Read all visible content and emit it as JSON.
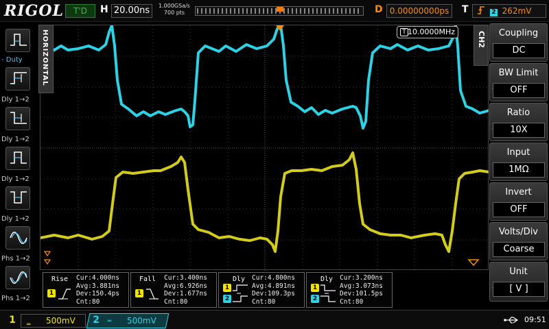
{
  "top": {
    "logo": "RIGOL",
    "trigger_status": "T'D",
    "h_label": "H",
    "timebase": "20.00ns",
    "sample_rate": "1.000GSa/s",
    "memory_depth": "700 pts",
    "d_label": "D",
    "delay": "0.00000000ps",
    "t_label": "T",
    "trigger_level": "262mV",
    "trigger_source": "2",
    "trigger_marker": "T"
  },
  "left_menu": {
    "horizontal_tab": "HORIZONTAL",
    "items": [
      {
        "label": "- Duty",
        "icon": "duty-cycle-icon"
      },
      {
        "label": "Dly 1→2",
        "icon": "delay-rise-rise-icon"
      },
      {
        "label": "Dly 1→2",
        "icon": "delay-fall-fall-icon"
      },
      {
        "label": "Dly 1→2",
        "icon": "delay-rise-fall-icon"
      },
      {
        "label": "Dly 1→2",
        "icon": "delay-fall-rise-icon"
      },
      {
        "label": "Phs 1→2",
        "icon": "phase-rise-icon"
      },
      {
        "label": "Phs 1→2",
        "icon": "phase-fall-icon"
      }
    ]
  },
  "grid": {
    "frequency": "10.0000MHz",
    "frequency_channel": "T"
  },
  "right_menu": {
    "channel_tab": "CH2",
    "items": [
      {
        "title": "Coupling",
        "value": "DC"
      },
      {
        "title": "BW Limit",
        "value": "OFF"
      },
      {
        "title": "Ratio",
        "value": "10X"
      },
      {
        "title": "Input",
        "value": "1MΩ"
      },
      {
        "title": "Invert",
        "value": "OFF"
      },
      {
        "title": "Volts/Div",
        "value": "Coarse"
      },
      {
        "title": "Unit",
        "value": "[ V ]"
      }
    ]
  },
  "measurements": [
    {
      "name": "Rise",
      "channels": [
        "1"
      ],
      "cur": "Cur:4.000ns",
      "avg": "Avg:3.881ns",
      "dev": "Dev:150.4ps",
      "cnt": "Cnt:80"
    },
    {
      "name": "Fall",
      "channels": [
        "1"
      ],
      "cur": "Cur:3.400ns",
      "avg": "Avg:6.926ns",
      "dev": "Dev:1.677ns",
      "cnt": "Cnt:80"
    },
    {
      "name": "Dly",
      "channels": [
        "1",
        "2"
      ],
      "cur": "Cur:4.800ns",
      "avg": "Avg:4.891ns",
      "dev": "Dev:109.3ps",
      "cnt": "Cnt:80"
    },
    {
      "name": "Dly",
      "channels": [
        "1",
        "2"
      ],
      "cur": "Cur:3.200ns",
      "avg": "Avg:3.073ns",
      "dev": "Dev:101.5ps",
      "cnt": "Cnt:80"
    }
  ],
  "bottom": {
    "ch1_num": "1",
    "ch1_scale": "500mV",
    "ch2_num": "2",
    "ch2_scale": "500mV",
    "time": "09:51"
  },
  "colors": {
    "ch1": "#f2e400",
    "ch2": "#2ad3e6",
    "accent": "#fb8c00"
  }
}
